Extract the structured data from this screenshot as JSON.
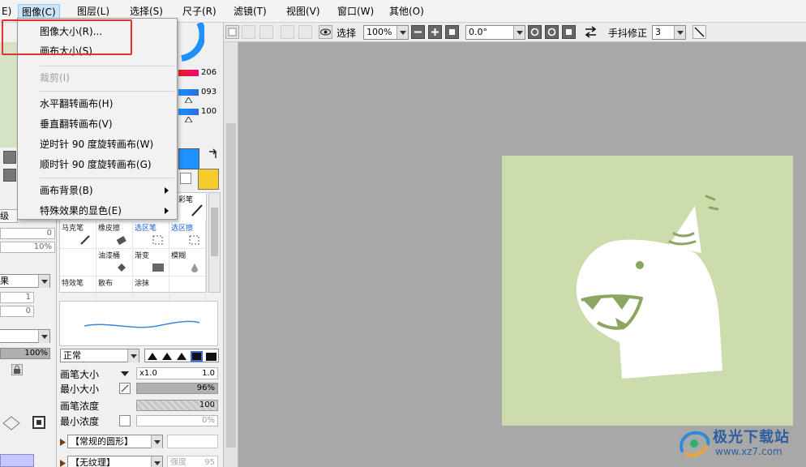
{
  "menubar": {
    "items": [
      {
        "label": "图像(C)"
      },
      {
        "label": "图层(L)"
      },
      {
        "label": "选择(S)"
      },
      {
        "label": "尺子(R)"
      },
      {
        "label": "滤镜(T)"
      },
      {
        "label": "视图(V)"
      },
      {
        "label": "窗口(W)"
      },
      {
        "label": "其他(O)"
      }
    ],
    "left_cut": "E)"
  },
  "toolbar": {
    "select_label": "选择",
    "zoom_value": "100%",
    "rotation_value": "0.0°",
    "stabilizer_label": "手抖修正",
    "stabilizer_value": "3"
  },
  "image_menu": {
    "items": [
      {
        "label": "图像大小(R)...",
        "enabled": true
      },
      {
        "label": "画布大小(S)",
        "enabled": true
      },
      {
        "label": "裁剪(I)",
        "enabled": false
      },
      {
        "label": "水平翻转画布(H)",
        "enabled": true
      },
      {
        "label": "垂直翻转画布(V)",
        "enabled": true
      },
      {
        "label": "逆时针 90 度旋转画布(W)",
        "enabled": true
      },
      {
        "label": "顺时针 90 度旋转画布(G)",
        "enabled": true
      },
      {
        "label": "画布背景(B)",
        "enabled": true,
        "submenu": true
      },
      {
        "label": "特殊效果的显色(E)",
        "enabled": true,
        "submenu": true
      }
    ]
  },
  "color_panel": {
    "rgb_values": [
      "206",
      "093",
      "100"
    ],
    "main_color": "#1e90ff",
    "sub_color": "#f5cc2a"
  },
  "left_panel": {
    "cut_label_1": "级",
    "value_0a": "0",
    "value_10a": "10%",
    "mode_combo": "果",
    "value_1": "1",
    "value_0b": "0",
    "opacity": "100%"
  },
  "tools": [
    {
      "label": "马克笔"
    },
    {
      "label": "橡皮擦"
    },
    {
      "label": "选区笔"
    },
    {
      "label": "选区擦"
    },
    {
      "label": ""
    },
    {
      "label": "油漆桶"
    },
    {
      "label": "渐变"
    },
    {
      "label": "模糊"
    },
    {
      "label": "特效笔"
    },
    {
      "label": "散布"
    },
    {
      "label": "涂抹"
    },
    {
      "label": ""
    }
  ],
  "tool_top_cut": "彩笔",
  "brush": {
    "blend_mode": "正常",
    "size_label": "画笔大小",
    "size_mult": "x1.0",
    "size_value": "1.0",
    "min_size_label": "最小大小",
    "min_size_value": "96%",
    "density_label": "画笔浓度",
    "density_value": "100",
    "min_density_label": "最小浓度",
    "min_density_value": "0%",
    "shape_label": "【常规的圆形】",
    "texture_label": "【无纹理】",
    "texture_value": "95",
    "texture_field_label": "强度"
  },
  "canvas": {
    "background": "#a8a8a8",
    "art_bg": "#ccdcac",
    "art_accent": "#8aa660"
  },
  "watermark": {
    "title": "极光下载站",
    "url": "www.xz7.com"
  }
}
